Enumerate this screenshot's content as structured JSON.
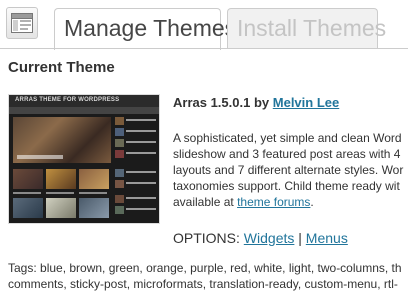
{
  "header": {
    "icon": "themes-icon",
    "tabs": [
      {
        "label": "Manage Themes",
        "active": true
      },
      {
        "label": "Install Themes",
        "active": false
      }
    ]
  },
  "section_title": "Current Theme",
  "theme": {
    "screenshot_banner": "ARRAS THEME FOR WORDPRESS",
    "name_version": "Arras 1.5.0.1",
    "by_word": "by",
    "author": "Melvin Lee",
    "description_lines": [
      "A sophisticated, yet simple and clean Word",
      "slideshow and 3 featured post areas with 4",
      "layouts and 7 different alternate styles. Wor",
      "taxonomies support. Child theme ready wit"
    ],
    "available_prefix": "available at",
    "forum_link": "theme forums",
    "available_suffix": "."
  },
  "options": {
    "label": "OPTIONS:",
    "widgets_link": "Widgets",
    "separator": "|",
    "menus_link": "Menus"
  },
  "tags": {
    "lines": [
      "Tags: blue, brown, green, orange, purple, red, white, light, two-columns, th",
      "comments, sticky-post, microformats, translation-ready, custom-menu, rtl-"
    ]
  },
  "colors": {
    "link": "#21759b",
    "text": "#333333",
    "inactive_tab_text": "#c4c4c4",
    "border": "#cccccc"
  }
}
